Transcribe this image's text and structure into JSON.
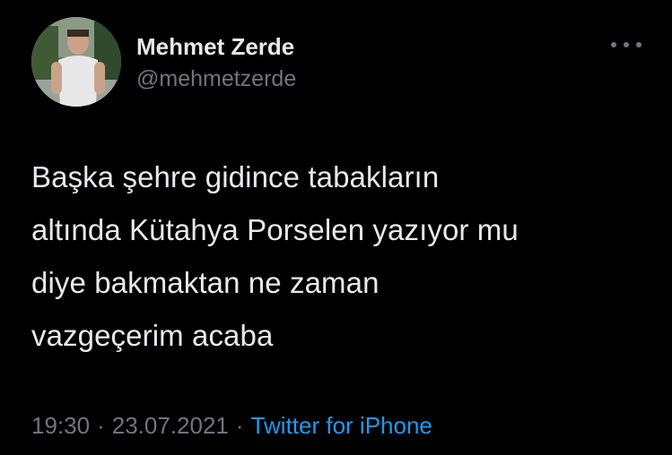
{
  "author": {
    "name": "Mehmet Zerde",
    "handle": "@mehmetzerde",
    "avatar_icon": "profile-photo"
  },
  "more_icon": "ellipsis-icon",
  "tweet": {
    "text": "Başka şehre gidince tabakların\naltında Kütahya Porselen yazıyor mu\ndiye bakmaktan ne zaman\nvazgeçerim acaba"
  },
  "meta": {
    "time": "19:30",
    "separator": "·",
    "date": "23.07.2021",
    "source": "Twitter for iPhone"
  },
  "colors": {
    "background": "#000000",
    "text": "#e7e9ea",
    "secondary": "#71767b",
    "link": "#1d9bf0"
  }
}
